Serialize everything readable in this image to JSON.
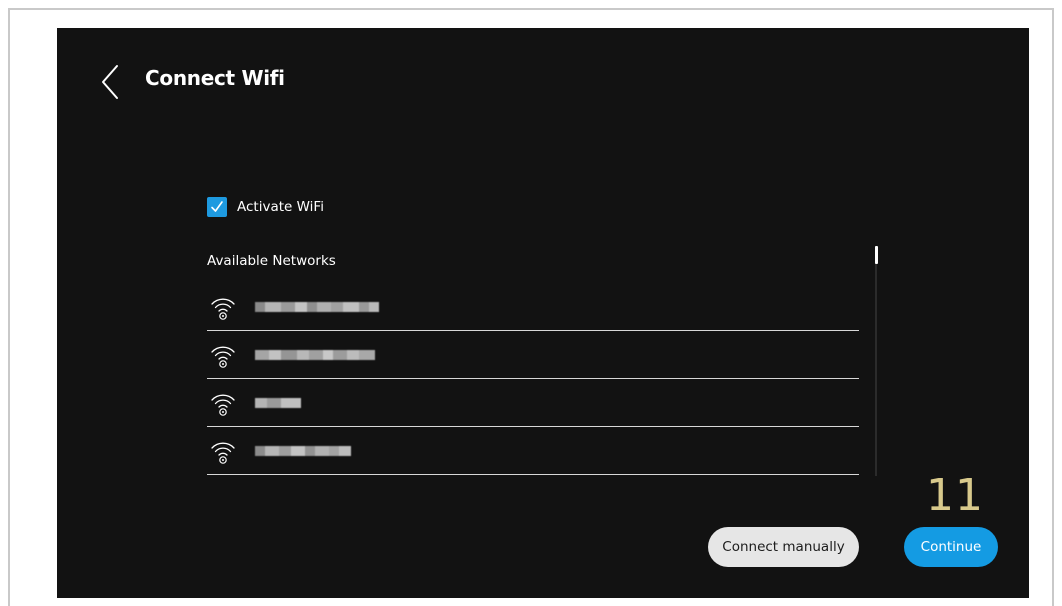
{
  "header": {
    "title": "Connect Wifi",
    "back_icon": "chevron-left-icon"
  },
  "wifi_toggle": {
    "label": "Activate WiFi",
    "checked": true,
    "check_color": "#1e9ae0"
  },
  "networks": {
    "heading": "Available Networks",
    "icon": "wifi-icon",
    "items": [
      {
        "ssid_visible": false
      },
      {
        "ssid_visible": false
      },
      {
        "ssid_visible": false
      },
      {
        "ssid_visible": false
      }
    ]
  },
  "step_indicator": "11",
  "buttons": {
    "connect_manually": "Connect manually",
    "continue": "Continue"
  },
  "colors": {
    "background": "#121212",
    "accent": "#149be3",
    "step_number": "#d8c98c"
  }
}
